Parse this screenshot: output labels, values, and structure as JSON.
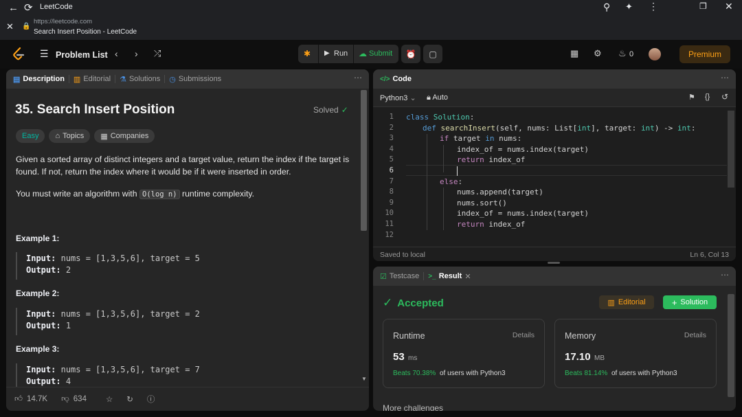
{
  "browser": {
    "tab_title": "LeetCode",
    "url": "https://leetcode.com",
    "page_title": "Search Insert Position - LeetCode"
  },
  "nav": {
    "problem_list": "Problem List",
    "run": "Run",
    "submit": "Submit",
    "streak_count": "0",
    "premium": "Premium"
  },
  "left": {
    "tabs": [
      "Description",
      "Editorial",
      "Solutions",
      "Submissions"
    ],
    "title": "35. Search Insert Position",
    "solved": "Solved",
    "difficulty": "Easy",
    "tags": [
      "Topics",
      "Companies"
    ],
    "para1": "Given a sorted array of distinct integers and a target value, return the index if the target is found. If not, return the index where it would be if it were inserted in order.",
    "para2_pre": "You must write an algorithm with",
    "para2_code": "O(log n)",
    "para2_post": "runtime complexity.",
    "examples": [
      {
        "title": "Example 1:",
        "input_label": "Input:",
        "input": "nums = [1,3,5,6], target = 5",
        "output_label": "Output:",
        "output": "2"
      },
      {
        "title": "Example 2:",
        "input_label": "Input:",
        "input": "nums = [1,3,5,6], target = 2",
        "output_label": "Output:",
        "output": "1"
      },
      {
        "title": "Example 3:",
        "input_label": "Input:",
        "input": "nums = [1,3,5,6], target = 7",
        "output_label": "Output:",
        "output": "4"
      }
    ],
    "likes": "14.7K",
    "dislikes": "634"
  },
  "code": {
    "header": "Code",
    "language": "Python3",
    "mode": "Auto",
    "line_numbers": [
      "1",
      "2",
      "3",
      "4",
      "5",
      "6",
      "7",
      "8",
      "9",
      "10",
      "11",
      "12"
    ],
    "status_left": "Saved to local",
    "status_right": "Ln 6, Col 13"
  },
  "result": {
    "tabs": [
      "Testcase",
      "Result"
    ],
    "status": "Accepted",
    "editorial_btn": "Editorial",
    "solution_btn": "Solution",
    "runtime": {
      "label": "Runtime",
      "details": "Details",
      "value": "53",
      "unit": "ms",
      "beats": "Beats 70.38%",
      "suffix": "of users with Python3"
    },
    "memory": {
      "label": "Memory",
      "details": "Details",
      "value": "17.10",
      "unit": "MB",
      "beats": "Beats 81.14%",
      "suffix": "of users with Python3"
    },
    "more": "More challenges"
  },
  "colors": {
    "accent_green": "#2cbb5d",
    "premium": "#ffa116",
    "easy": "#00b8a3"
  }
}
